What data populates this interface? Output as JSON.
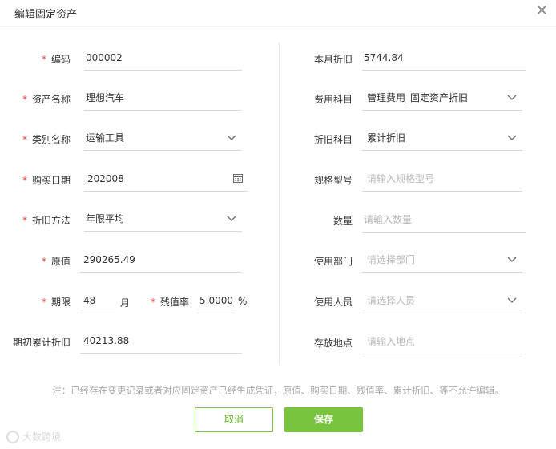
{
  "dialog": {
    "title": "编辑固定资产"
  },
  "left": {
    "code": {
      "label": "编码",
      "value": "000002"
    },
    "asset_name": {
      "label": "资产名称",
      "value": "理想汽车"
    },
    "category": {
      "label": "类别名称",
      "value": "运输工具"
    },
    "purchase_date": {
      "label": "购买日期",
      "value": "202008"
    },
    "depreciation_method": {
      "label": "折旧方法",
      "value": "年限平均"
    },
    "original_value": {
      "label": "原值",
      "value": "290265.49"
    },
    "term": {
      "label": "期限",
      "value": "48",
      "unit": "月"
    },
    "residual_rate": {
      "label": "残值率",
      "value": "5.0000",
      "unit": "%"
    },
    "initial_accum_depr": {
      "label": "期初累计折旧",
      "value": "40213.88"
    }
  },
  "right": {
    "monthly_depr": {
      "label": "本月折旧",
      "value": "5744.84"
    },
    "expense_account": {
      "label": "费用科目",
      "value": "管理费用_固定资产折旧"
    },
    "depr_account": {
      "label": "折旧科目",
      "value": "累计折旧"
    },
    "spec_model": {
      "label": "规格型号",
      "placeholder": "请输入规格型号"
    },
    "quantity": {
      "label": "数量",
      "placeholder": "请输入数量"
    },
    "department": {
      "label": "使用部门",
      "placeholder": "请选择部门"
    },
    "user": {
      "label": "使用人员",
      "placeholder": "请选择人员"
    },
    "location": {
      "label": "存放地点",
      "placeholder": "请输入地点"
    }
  },
  "note": "注：已经存在变更记录或者对应固定资产已经生成凭证，原值、购买日期、残值率、累计折旧、等不允许编辑。",
  "buttons": {
    "cancel": "取消",
    "save": "保存"
  },
  "watermark": "大数跨境",
  "colors": {
    "accent": "#79c43f",
    "required": "#e34040"
  }
}
